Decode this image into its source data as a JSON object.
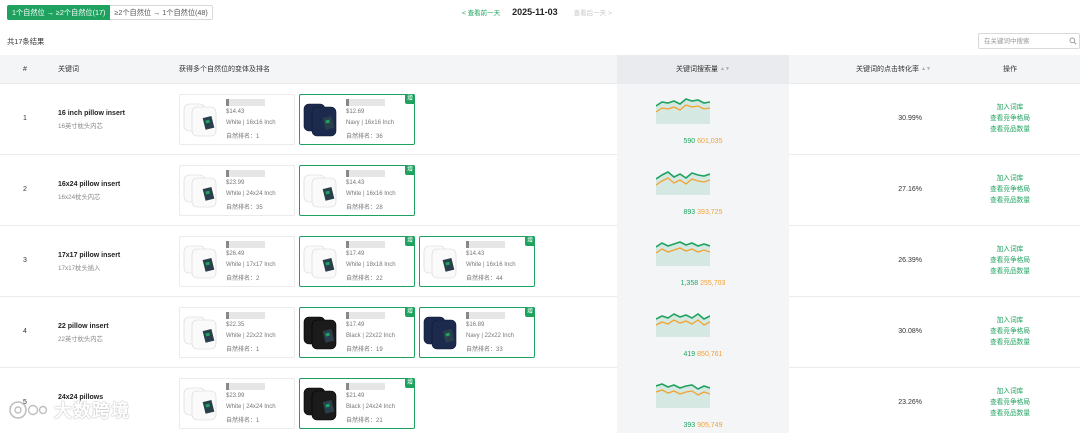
{
  "filters": {
    "options": [
      "1个自然位 → ≥2个自然位(17)",
      "≥2个自然位 → 1个自然位(48)"
    ],
    "active_index": 0
  },
  "date_nav": {
    "prev": "< 查看前一天",
    "date": "2025-11-03",
    "next": "查看后一天 >"
  },
  "summary": {
    "total": "共17条结果"
  },
  "search": {
    "placeholder": "在关键词中搜索",
    "icon": "search-icon"
  },
  "columns": {
    "index": "#",
    "keyword": "关键词",
    "variants": "获得多个自然位的变体及排名",
    "search_volume": "关键词搜索量",
    "ctr": "关键词的点击转化率",
    "actions": "操作"
  },
  "actions": [
    "加入词库",
    "查看竞争格局",
    "查看竞品数量"
  ],
  "colors": {
    "accent": "#1fa260",
    "volume_secondary": "#f2a231",
    "highlight_column": "#f4f5f7"
  },
  "watermark": "大数跨境",
  "rows": [
    {
      "index": "1",
      "keyword": "16 inch pillow insert",
      "keyword_cn": "16英寸枕头内芯",
      "volume_a": "590",
      "volume_b": "601,035",
      "ctr": "30.99%",
      "products": [
        {
          "title_initial": "E",
          "price": "$14.43",
          "variant": "White | 16x16 Inch",
          "rank": "自然排名：1",
          "color": "white",
          "tagged": false
        },
        {
          "title_initial": "E",
          "price": "$12.69",
          "variant": "Navy | 16x16 Inch",
          "rank": "自然排名：36",
          "color": "navy",
          "tagged": true,
          "tag": "增"
        }
      ]
    },
    {
      "index": "2",
      "keyword": "16x24 pillow insert",
      "keyword_cn": "16x24枕头内芯",
      "volume_a": "893",
      "volume_b": "393,725",
      "ctr": "27.16%",
      "products": [
        {
          "title_initial": "E",
          "price": "$23.99",
          "variant": "White | 24x24 Inch",
          "rank": "自然排名：35",
          "color": "white",
          "tagged": false
        },
        {
          "title_initial": "E",
          "price": "$14.43",
          "variant": "White | 16x16 Inch",
          "rank": "自然排名：28",
          "color": "white",
          "tagged": true,
          "tag": "增"
        }
      ]
    },
    {
      "index": "3",
      "keyword": "17x17 pillow insert",
      "keyword_cn": "17x17枕头插入",
      "volume_a": "1,358",
      "volume_b": "255,703",
      "ctr": "26.39%",
      "products": [
        {
          "title_initial": "",
          "price": "$26.49",
          "variant": "White | 17x17 Inch",
          "rank": "自然排名：2",
          "color": "white",
          "tagged": false
        },
        {
          "title_initial": "",
          "price": "$17.49",
          "variant": "White | 18x18 Inch",
          "rank": "自然排名：22",
          "color": "white",
          "tagged": true,
          "tag": "增"
        },
        {
          "title_initial": "E",
          "price": "$14.43",
          "variant": "White | 16x16 Inch",
          "rank": "自然排名：44",
          "color": "white",
          "tagged": true,
          "tag": "增"
        }
      ]
    },
    {
      "index": "4",
      "keyword": "22 pillow insert",
      "keyword_cn": "22英寸枕头内芯",
      "volume_a": "419",
      "volume_b": "850,761",
      "ctr": "30.08%",
      "products": [
        {
          "title_initial": "",
          "price": "$22.35",
          "variant": "White | 22x22 Inch",
          "rank": "自然排名：1",
          "color": "white",
          "tagged": false
        },
        {
          "title_initial": "",
          "price": "$17.49",
          "variant": "Black | 22x22 Inch",
          "rank": "自然排名：19",
          "color": "black",
          "tagged": true,
          "tag": "增"
        },
        {
          "title_initial": "",
          "price": "$16.89",
          "variant": "Navy | 22x22 Inch",
          "rank": "自然排名：33",
          "color": "navy",
          "tagged": true,
          "tag": "增"
        }
      ]
    },
    {
      "index": "5",
      "keyword": "24x24 pillows",
      "keyword_cn": "",
      "volume_a": "393",
      "volume_b": "905,749",
      "ctr": "23.26%",
      "products": [
        {
          "title_initial": "",
          "price": "$23.99",
          "variant": "White | 24x24 Inch",
          "rank": "自然排名：1",
          "color": "white",
          "tagged": false
        },
        {
          "title_initial": "E",
          "price": "$21.49",
          "variant": "Black | 24x24 Inch",
          "rank": "自然排名：21",
          "color": "black",
          "tagged": true,
          "tag": "增"
        }
      ]
    }
  ]
}
